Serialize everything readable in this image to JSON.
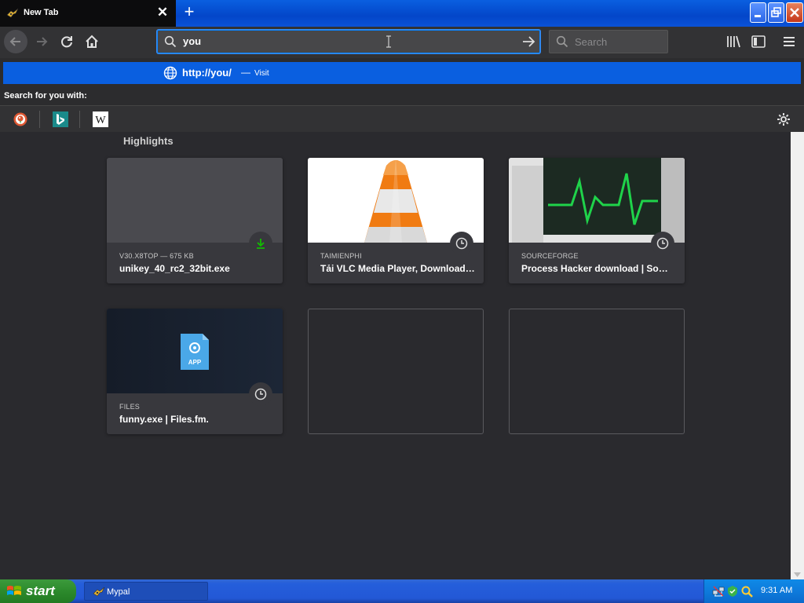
{
  "tab": {
    "title": "New Tab",
    "close_icon": "close-icon",
    "new_tab_icon": "plus-icon"
  },
  "window_buttons": {
    "minimize": "minimize-icon",
    "restore": "restore-icon",
    "close": "close-icon"
  },
  "navbar": {
    "url_value": "you",
    "search_placeholder": "Search"
  },
  "dropdown": {
    "suggestion_url": "http://you/",
    "suggestion_dash": "—",
    "suggestion_action": "Visit",
    "search_for_label": "Search for you with:",
    "engines": [
      "duckduckgo-icon",
      "bing-icon",
      "wikipedia-icon"
    ]
  },
  "content": {
    "section_title": "Highlights",
    "cards": [
      {
        "context": "V30.X8TOP — 675 KB",
        "title": "unikey_40_rc2_32bit.exe",
        "badge": "download-icon"
      },
      {
        "context": "TAIMIENPHI",
        "title": "Tải VLC Media Player, Download…",
        "badge": "clock-icon"
      },
      {
        "context": "SOURCEFORGE",
        "title": "Process Hacker download | So…",
        "badge": "clock-icon"
      },
      {
        "context": "FILES",
        "title": "funny.exe | Files.fm.",
        "badge": "clock-icon",
        "file_label": "APP"
      }
    ]
  },
  "taskbar": {
    "start_label": "start",
    "task_item": "Mypal",
    "clock": "9:31 AM"
  },
  "colors": {
    "accent": "#0a5fe0",
    "content_bg": "#2a2a2e",
    "card_bg": "#38383d",
    "download_green": "#12bc00"
  }
}
